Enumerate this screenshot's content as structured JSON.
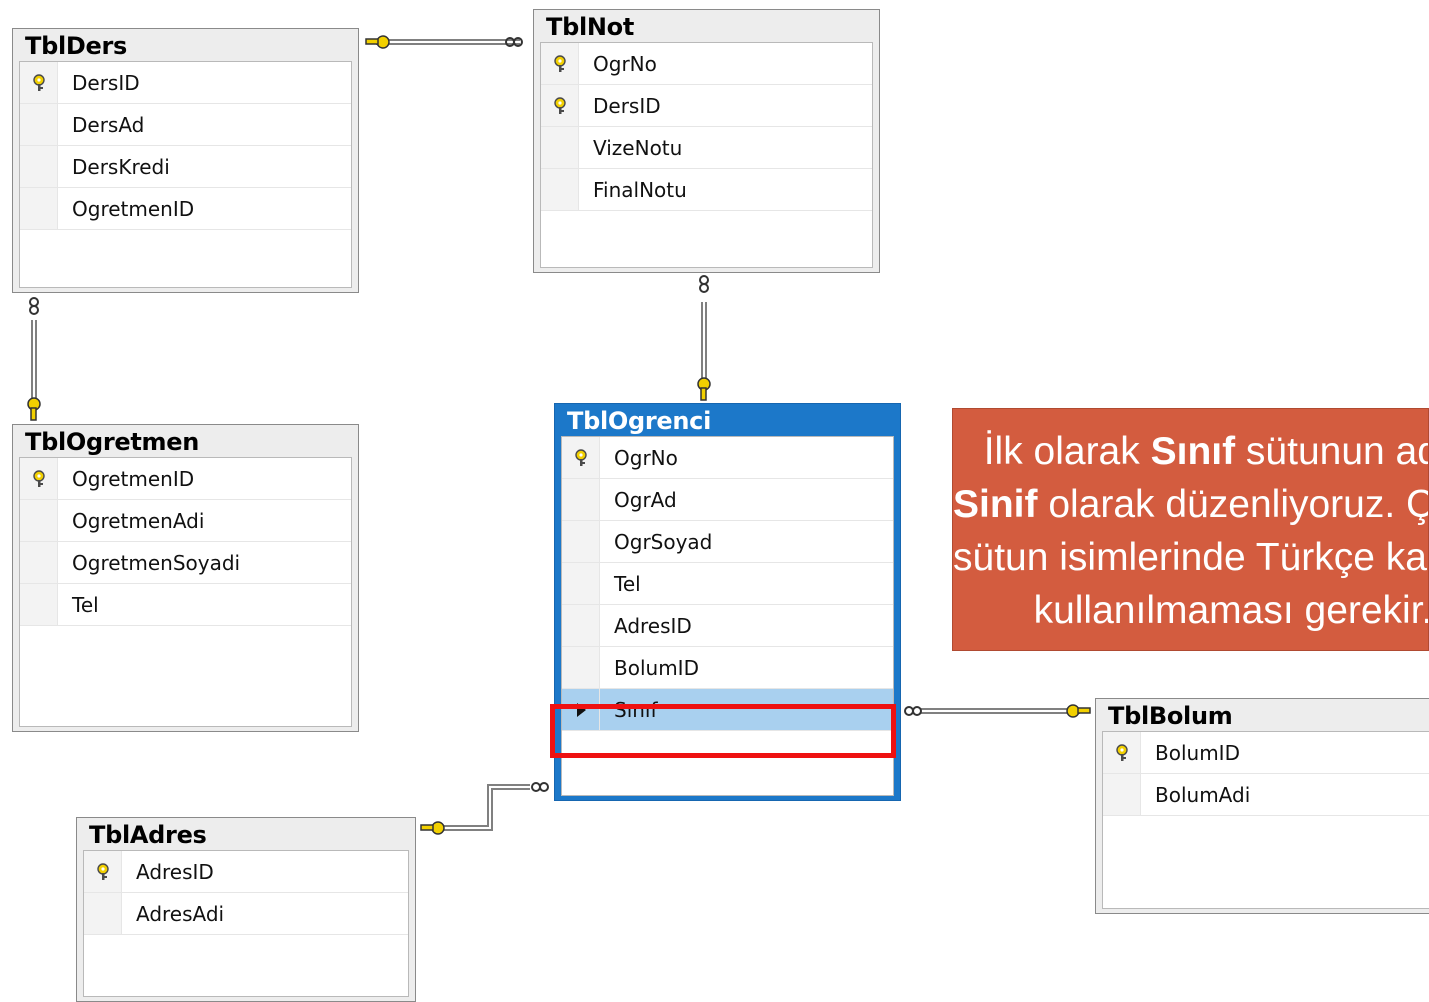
{
  "colors": {
    "selected_title_bar": "#1c78c9",
    "highlight_row": "#a9d0ef",
    "selection_box": "#ee1111",
    "callout_bg": "#d35c3f",
    "key_icon": "#f2d000"
  },
  "tables": {
    "ders": {
      "title": "TblDers",
      "columns": [
        "DersID",
        "DersAd",
        "DersKredi",
        "OgretmenID"
      ]
    },
    "not": {
      "title": "TblNot",
      "columns": [
        "OgrNo",
        "DersID",
        "VizeNotu",
        "FinalNotu"
      ]
    },
    "ogretmen": {
      "title": "TblOgretmen",
      "columns": [
        "OgretmenID",
        "OgretmenAdi",
        "OgretmenSoyadi",
        "Tel"
      ]
    },
    "ogrenci": {
      "title": "TblOgrenci",
      "columns": [
        "OgrNo",
        "OgrAd",
        "OgrSoyad",
        "Tel",
        "AdresID",
        "BolumID",
        "Sınıf"
      ]
    },
    "adres": {
      "title": "TblAdres",
      "columns": [
        "AdresID",
        "AdresAdi"
      ]
    },
    "bolum": {
      "title": "TblBolum",
      "columns": [
        "BolumID",
        "BolumAdi"
      ]
    }
  },
  "callout": {
    "line1_a": "İlk olarak ",
    "line1_b": "Sınıf",
    "line1_c": " sütunun adını",
    "line2_a": "Sinif",
    "line2_b": " olarak düzenliyoruz. Çünkü",
    "line3": "sütun isimlerinde Türkçe karakter",
    "line4": "kullanılmaması gerekir."
  }
}
